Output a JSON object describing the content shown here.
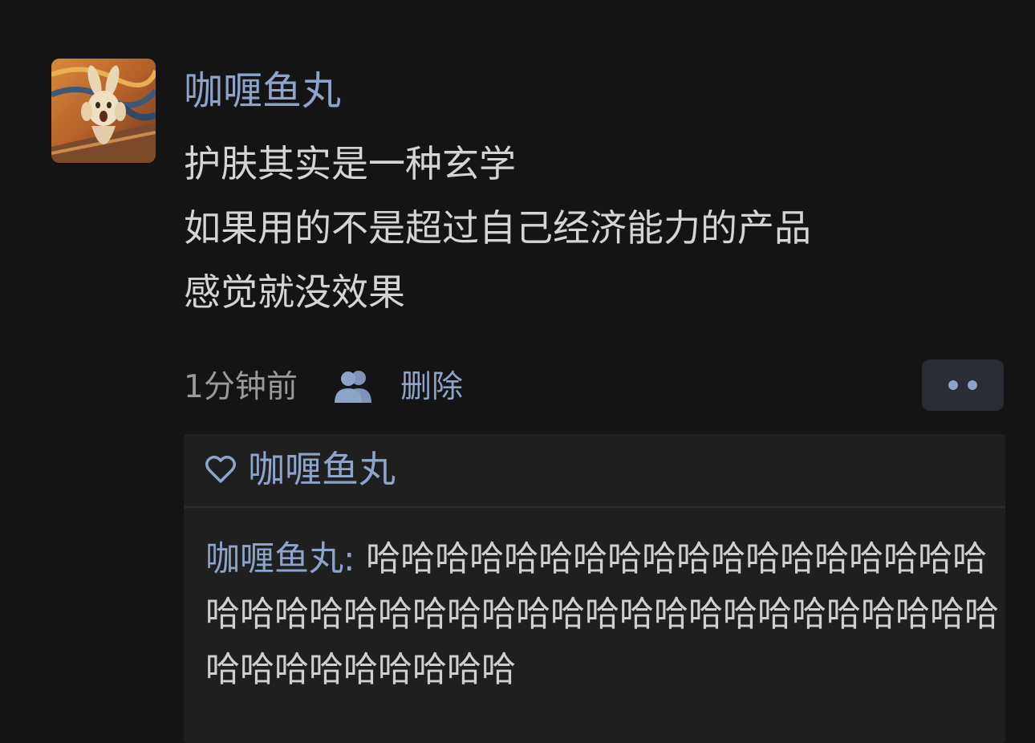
{
  "post": {
    "avatar_icon": "rabbit-scream-avatar",
    "username": "咖喱鱼丸",
    "lines": [
      "护肤其实是一种玄学",
      "如果用的不是超过自己经济能力的产品",
      "感觉就没效果"
    ],
    "timestamp": "1分钟前",
    "visibility_icon": "friends-icon",
    "delete_label": "删除",
    "more_icon": "more-dots-icon"
  },
  "likes": {
    "icon": "heart-icon",
    "name": "咖喱鱼丸"
  },
  "comment": {
    "author": "咖喱鱼丸",
    "separator": ":",
    "text": " 哈哈哈哈哈哈哈哈哈哈哈哈哈哈哈哈哈哈哈哈哈哈哈哈哈哈哈哈哈哈哈哈哈哈哈哈哈哈哈哈哈哈哈哈哈哈哈哈哈哈"
  },
  "colors": {
    "background": "#141414",
    "link": "#8ea3c8",
    "text": "#d4d4d4",
    "muted": "#9a9a9a",
    "panel": "#1f1f20"
  }
}
